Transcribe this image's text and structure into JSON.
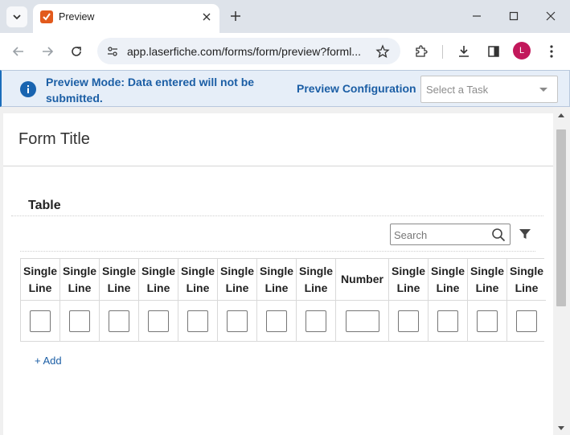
{
  "browser": {
    "tab_title": "Preview",
    "url": "app.laserfiche.com/forms/form/preview?forml...",
    "avatar_letter": "L"
  },
  "banner": {
    "message": "Preview Mode: Data entered will not be submitted.",
    "config_label": "Preview Configuration",
    "task_placeholder": "Select a Task"
  },
  "form": {
    "title": "Form Title",
    "section_title": "Table",
    "search_placeholder": "Search",
    "add_label": "+ Add",
    "columns": [
      {
        "l1": "Single",
        "l2": "Line"
      },
      {
        "l1": "Single",
        "l2": "Line"
      },
      {
        "l1": "Single",
        "l2": "Line"
      },
      {
        "l1": "Single",
        "l2": "Line"
      },
      {
        "l1": "Single",
        "l2": "Line"
      },
      {
        "l1": "Single",
        "l2": "Line"
      },
      {
        "l1": "Single",
        "l2": "Line"
      },
      {
        "l1": "Single",
        "l2": "Line"
      },
      {
        "l1": "Number",
        "l2": ""
      },
      {
        "l1": "Single",
        "l2": "Line"
      },
      {
        "l1": "Single",
        "l2": "Line"
      },
      {
        "l1": "Single",
        "l2": "Line"
      },
      {
        "l1": "Single",
        "l2": "Line"
      }
    ]
  },
  "colors": {
    "accent": "#1b5ea5",
    "banner_bg": "#e6eef8",
    "favicon": "#e25a1c",
    "avatar": "#c2185b"
  }
}
